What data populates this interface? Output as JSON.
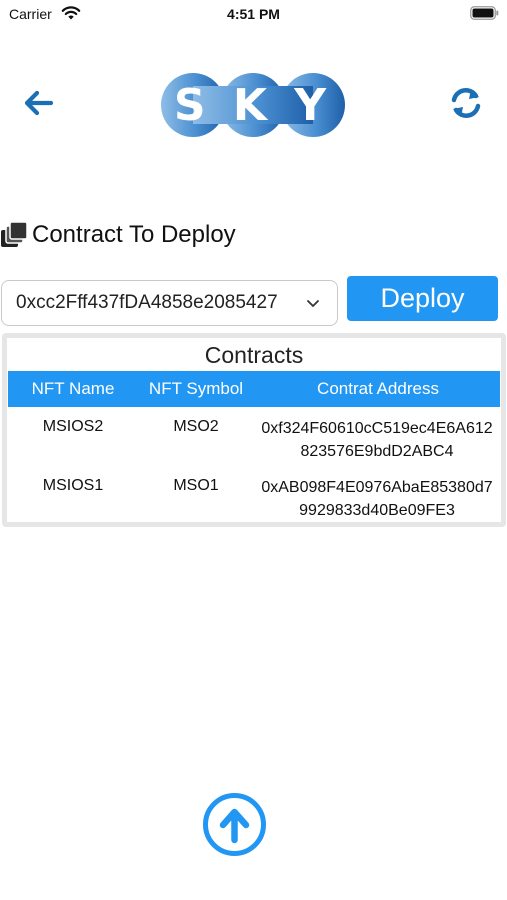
{
  "status_bar": {
    "carrier": "Carrier",
    "time": "4:51 PM",
    "wifi_icon": "wifi-icon",
    "battery_icon": "battery-icon"
  },
  "header": {
    "back_icon": "arrow-left-icon",
    "logo_text": "S K Y",
    "refresh_icon": "refresh-icon"
  },
  "section": {
    "icon": "contracts-stack-icon",
    "title": "Contract To Deploy"
  },
  "contract_select": {
    "value": "0xcc2Fff437fDA4858e2085427"
  },
  "deploy_button": {
    "label": "Deploy"
  },
  "contracts_table": {
    "title": "Contracts",
    "columns": [
      "NFT Name",
      "NFT Symbol",
      "Contrat Address"
    ],
    "rows": [
      {
        "name": "MSIOS2",
        "symbol": "MSO2",
        "address": "0xf324F60610cC519ec4E6A612823576E9bdD2ABC4"
      },
      {
        "name": "MSIOS1",
        "symbol": "MSO1",
        "address": "0xAB098F4E0976AbaE85380d79929833d40Be09FE3"
      }
    ]
  },
  "upload_button": {
    "icon": "upload-arrow-icon"
  },
  "colors": {
    "accent": "#2196f3",
    "icon_blue": "#1b6fb5",
    "logo_light": "#7fb2e0",
    "logo_dark": "#1f5fa8"
  }
}
